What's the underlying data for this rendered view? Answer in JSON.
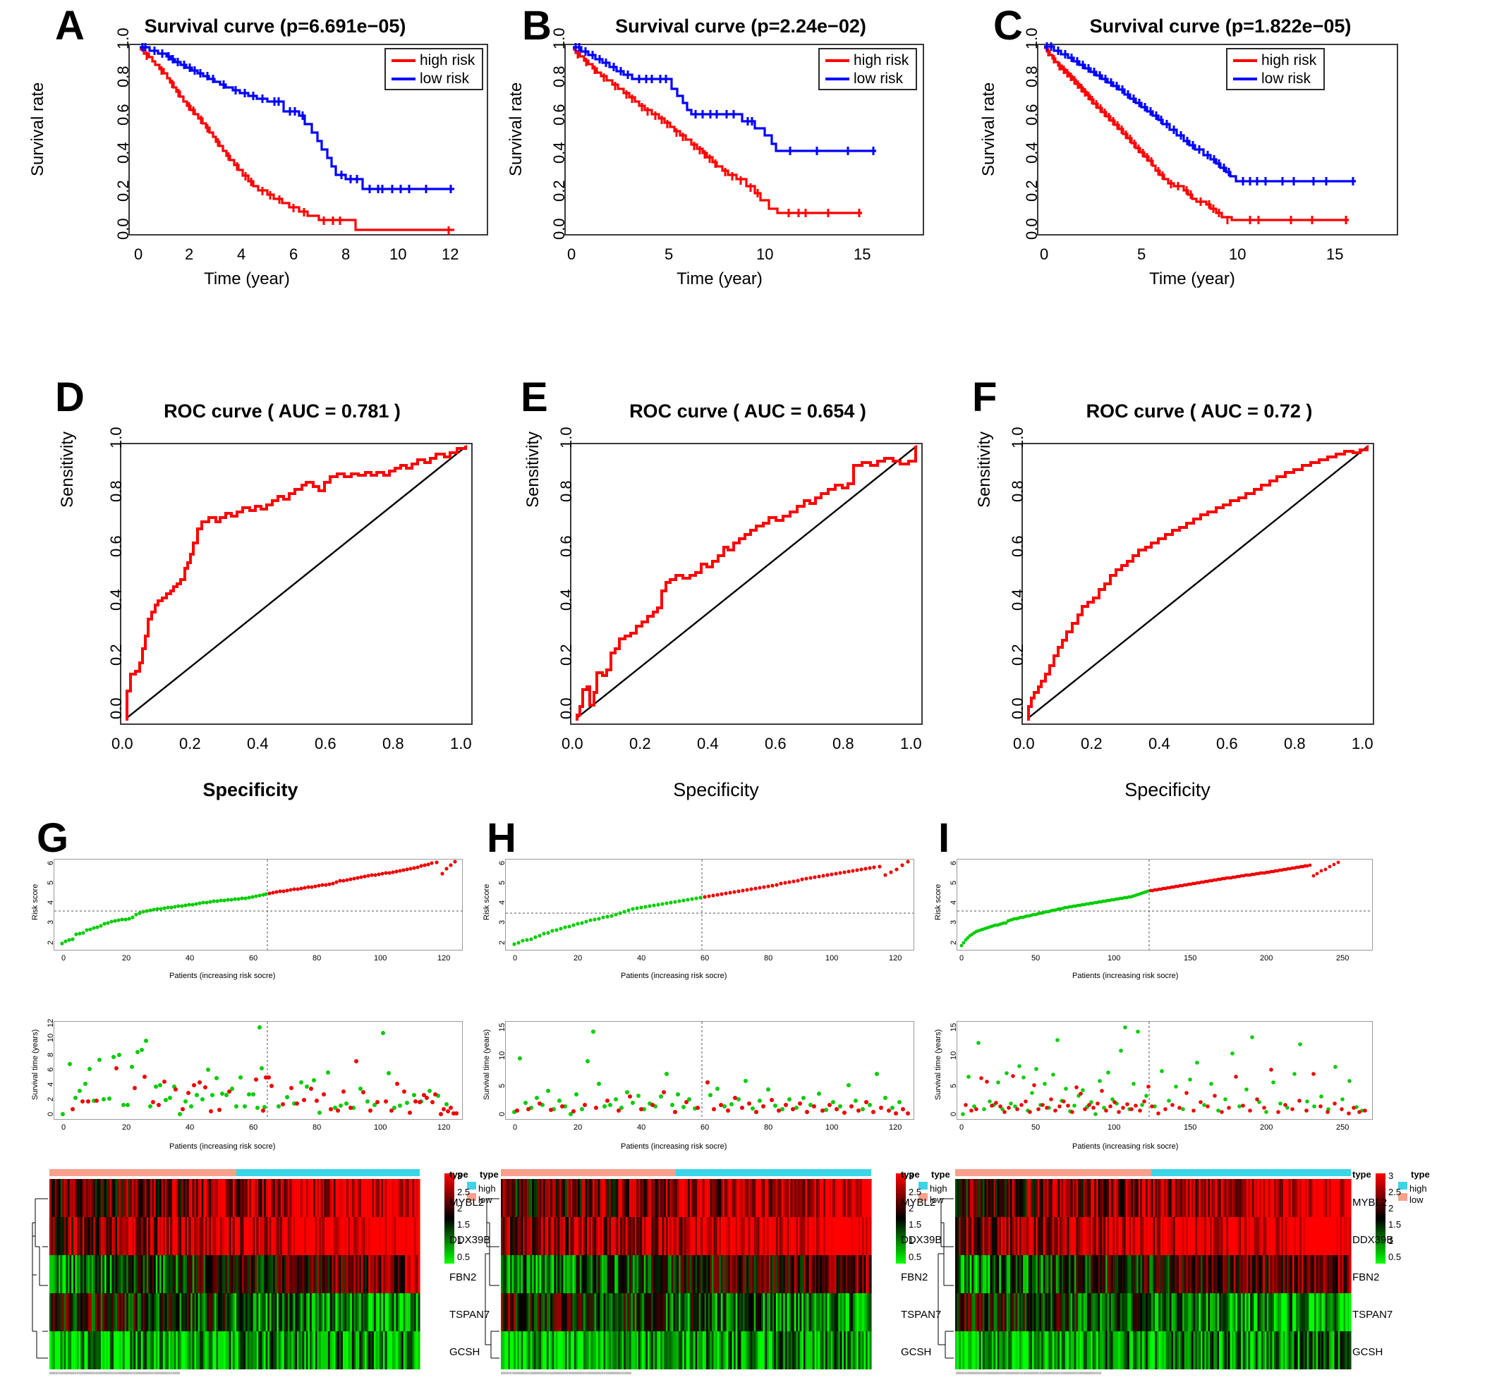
{
  "figure": {
    "panels": [
      "A",
      "B",
      "C",
      "D",
      "E",
      "F",
      "G",
      "H",
      "I"
    ]
  },
  "survival": {
    "A": {
      "letter": "A",
      "title": "Survival curve (p=6.691e−05)",
      "xlabel": "Time (year)",
      "ylabel": "Survival rate",
      "xticks": [
        "0",
        "2",
        "4",
        "6",
        "8",
        "10",
        "12"
      ],
      "yticks": [
        "0.0",
        "0.2",
        "0.4",
        "0.6",
        "0.8",
        "1.0"
      ],
      "legend": [
        {
          "label": "high risk",
          "color": "#ff0000"
        },
        {
          "label": "low risk",
          "color": "#0000ff"
        }
      ]
    },
    "B": {
      "letter": "B",
      "title": "Survival curve (p=2.24e−02)",
      "xlabel": "Time (year)",
      "ylabel": "Survival rate",
      "xticks": [
        "0",
        "5",
        "10",
        "15"
      ],
      "yticks": [
        "0.0",
        "0.2",
        "0.4",
        "0.6",
        "0.8",
        "1.0"
      ],
      "legend": [
        {
          "label": "high risk",
          "color": "#ff0000"
        },
        {
          "label": "low risk",
          "color": "#0000ff"
        }
      ]
    },
    "C": {
      "letter": "C",
      "title": "Survival curve (p=1.822e−05)",
      "xlabel": "Time (year)",
      "ylabel": "Survival rate",
      "xticks": [
        "0",
        "5",
        "10",
        "15"
      ],
      "yticks": [
        "0.0",
        "0.2",
        "0.4",
        "0.6",
        "0.8",
        "1.0"
      ],
      "legend": [
        {
          "label": "high risk",
          "color": "#ff0000"
        },
        {
          "label": "low risk",
          "color": "#0000ff"
        }
      ]
    }
  },
  "roc": {
    "D": {
      "letter": "D",
      "title": "ROC curve ( AUC =  0.781 )",
      "auc": 0.781,
      "xlabel": "Specificity",
      "ylabel": "Sensitivity",
      "xticks": [
        "0.0",
        "0.2",
        "0.4",
        "0.6",
        "0.8",
        "1.0"
      ],
      "yticks": [
        "0.0",
        "0.2",
        "0.4",
        "0.6",
        "0.8",
        "1.0"
      ]
    },
    "E": {
      "letter": "E",
      "title": "ROC curve ( AUC =  0.654 )",
      "auc": 0.654,
      "xlabel": "Specificity",
      "ylabel": "Sensitivity",
      "xticks": [
        "0.0",
        "0.2",
        "0.4",
        "0.6",
        "0.8",
        "1.0"
      ],
      "yticks": [
        "0.0",
        "0.2",
        "0.4",
        "0.6",
        "0.8",
        "1.0"
      ]
    },
    "F": {
      "letter": "F",
      "title": "ROC curve ( AUC =  0.72 )",
      "auc": 0.72,
      "xlabel": "Specificity",
      "ylabel": "Sensitivity",
      "xticks": [
        "0.0",
        "0.2",
        "0.4",
        "0.6",
        "0.8",
        "1.0"
      ],
      "yticks": [
        "0.0",
        "0.2",
        "0.4",
        "0.6",
        "0.8",
        "1.0"
      ]
    }
  },
  "riskgroups": {
    "G": {
      "letter": "G",
      "riskscore": {
        "ylabel": "Risk score",
        "xlabel": "Patients (increasing risk socre)",
        "xticks": [
          "0",
          "20",
          "40",
          "60",
          "80",
          "100",
          "120"
        ],
        "yticks": [
          "2",
          "3",
          "4",
          "5",
          "6"
        ],
        "cutoff_x": 64,
        "cutoff_y": 3.55,
        "n_patients": 128
      },
      "survtime": {
        "ylabel": "Survival time (years)",
        "xlabel": "Patients (increasing risk socre)",
        "xticks": [
          "0",
          "20",
          "40",
          "60",
          "80",
          "100",
          "120"
        ],
        "yticks": [
          "0",
          "2",
          "4",
          "6",
          "8",
          "10",
          "12"
        ],
        "cutoff_x": 64,
        "n_patients": 128
      }
    },
    "H": {
      "letter": "H",
      "riskscore": {
        "ylabel": "Risk score",
        "xlabel": "Patients (increasing risk socre)",
        "xticks": [
          "0",
          "20",
          "40",
          "60",
          "80",
          "100",
          "120"
        ],
        "yticks": [
          "2",
          "3",
          "4",
          "5",
          "6"
        ],
        "cutoff_x": 59,
        "cutoff_y": 3.5,
        "n_patients": 128
      },
      "survtime": {
        "ylabel": "Survival time (years)",
        "xlabel": "Patients (increasing risk socre)",
        "xticks": [
          "0",
          "20",
          "40",
          "60",
          "80",
          "100",
          "120"
        ],
        "yticks": [
          "0",
          "5",
          "10",
          "15"
        ],
        "cutoff_x": 59,
        "n_patients": 128
      }
    },
    "I": {
      "letter": "I",
      "riskscore": {
        "ylabel": "Risk score",
        "xlabel": "Patients (increasing risk socre)",
        "xticks": [
          "0",
          "50",
          "100",
          "150",
          "200",
          "250"
        ],
        "yticks": [
          "2",
          "3",
          "4",
          "5",
          "6"
        ],
        "cutoff_x": 123,
        "cutoff_y": 3.55,
        "n_patients": 256
      },
      "survtime": {
        "ylabel": "Survival time (years)",
        "xlabel": "Patients (increasing risk socre)",
        "xticks": [
          "0",
          "50",
          "100",
          "150",
          "200",
          "250"
        ],
        "yticks": [
          "0",
          "5",
          "10",
          "15"
        ],
        "cutoff_x": 123,
        "n_patients": 256
      }
    }
  },
  "heatmap": {
    "genes": [
      "MYBL2",
      "DDX39B",
      "FBN2",
      "TSPAN7",
      "GCSH"
    ],
    "annotation_label": "type",
    "scale_ticks": [
      "3",
      "2.5",
      "2",
      "1.5",
      "1",
      "0.5"
    ],
    "type_legend_title": "type",
    "type_legend": [
      {
        "label": "high",
        "color": "#3ad6e8"
      },
      {
        "label": "low",
        "color": "#f8a08c"
      }
    ],
    "low_color": "#f8a08c",
    "high_color": "#3ad6e8"
  },
  "colors": {
    "high_risk": "#ff0000",
    "low_risk": "#0000ff",
    "alive_green": "#00cc00",
    "dead_red": "#ee0000",
    "axis": "#3a3a3a",
    "heat_high": "#ff0000",
    "heat_mid": "#000000",
    "heat_low": "#00ff00"
  }
}
